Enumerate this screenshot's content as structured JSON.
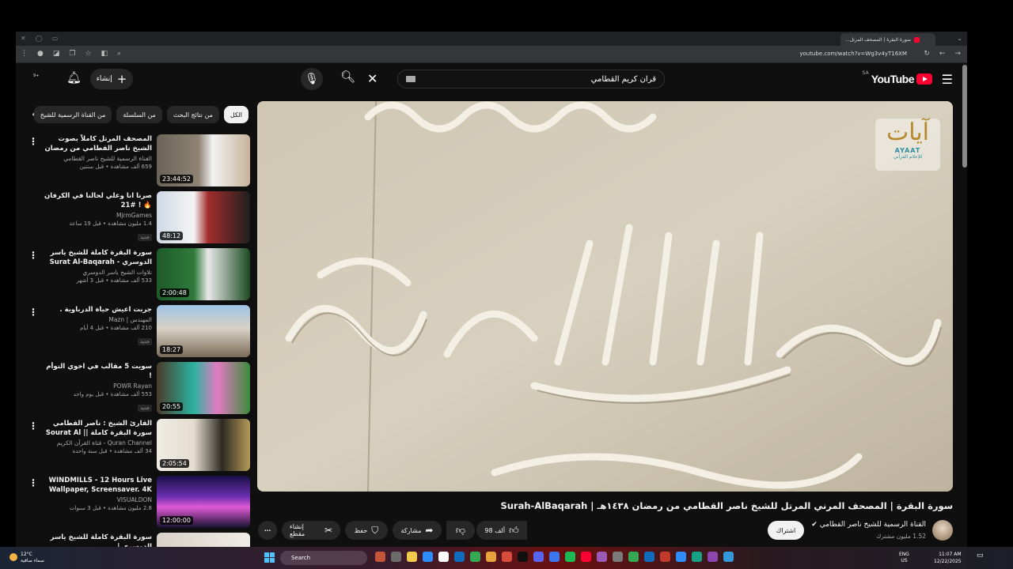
{
  "browser": {
    "tab_title": "سورة البقرة | المصحف المرتل...",
    "url": "youtube.com/watch?v=Wg3v4yT16XM"
  },
  "header": {
    "logo_text": "YouTube",
    "country_code": "SA",
    "search_query": "قران كريم القطامي",
    "create_label": "إنشاء",
    "notif_count": "9+"
  },
  "chips": [
    "الكل",
    "من نتائج البحث",
    "من السلسلة",
    "من القناة الرسمية للشيخ"
  ],
  "related": [
    {
      "title": "المصحف المرتل كاملاً بصوت الشيخ ناصر القطامي من رمضان 1444هـ.",
      "channel": "القناة الرسمية للشيخ ناصر القطامي",
      "meta": "659 ألف مشاهدة • قبل سنتين",
      "duration": "23:44:52",
      "badge": ""
    },
    {
      "title": "صرنا انا وعلي لحالنا في الكرفان 🔥 ! #21",
      "channel": "MjrmGames",
      "meta": "1.4 مليون مشاهدة • قبل 19 ساعة",
      "duration": "48:12",
      "badge": "جديد"
    },
    {
      "title": "سورة البقرة كاملة للشيخ ياسر الدوسري - Surat Al-Baqarah",
      "channel": "تلاوات الشيخ ياسر الدوسري",
      "meta": "533 ألف مشاهدة • قبل 3 أشهر",
      "duration": "2:00:48",
      "badge": ""
    },
    {
      "title": "جربت اعيش حياة الدرباوية .",
      "channel": "المهندس | Mazn",
      "meta": "210 ألف مشاهدة • قبل 4 أيام",
      "duration": "18:27",
      "badge": "جديد"
    },
    {
      "title": "سويت 5 مقالب في اخوي التوأم !",
      "channel": "POWR Rayan",
      "meta": "553 ألف مشاهدة • قبل يوم واحد",
      "duration": "20:55",
      "badge": "جديد"
    },
    {
      "title": "القارئ الشيخ : ناصر القطامي سورة البقرة كاملة || Sourat Al baqarah ...",
      "channel": "Quran Channel - قناة القرآن الكريم",
      "meta": "34 ألف مشاهدة • قبل سنة واحدة",
      "duration": "2:05:54",
      "badge": ""
    },
    {
      "title": "WINDMILLS - 12 Hours Live Wallpaper, Screensaver. 4K Ultra...",
      "channel": "VISUALDON",
      "meta": "2.8 مليون مشاهدة • قبل 3 سنوات",
      "duration": "12:00:00",
      "badge": ""
    },
    {
      "title": "سورة البقرة كاملة للشيخ ياسر الدوسري |",
      "channel": "",
      "meta": "",
      "duration": "",
      "badge": ""
    }
  ],
  "video": {
    "title": "سورة البقرة | المصحف المرني المرتل للشيخ ناصر القطامي من رمضان ١٤٣٨هـ | Surah-AlBaqarah",
    "channel": "القناة الرسمية للشيخ ناصر القطامي",
    "subscribers": "1.52 مليون مشترك",
    "subscribe_label": "اشتراك",
    "likes": "98 ألف",
    "share_label": "مشاركة",
    "save_label": "حفظ",
    "clip_label": "إنشاء مقطع",
    "watermark_big": "آيات",
    "watermark_name": "AYAAT",
    "watermark_sub": "للإعلام القرآني"
  },
  "taskbar": {
    "temp": "12°C",
    "weather": "سماء صافية",
    "search_label": "Search",
    "lang": "ENG",
    "region": "US",
    "time": "11:07 AM",
    "date": "12/22/2025"
  },
  "colors": {
    "accent": "#ff0033",
    "bg": "#0f0f0f",
    "chip": "#272727"
  }
}
